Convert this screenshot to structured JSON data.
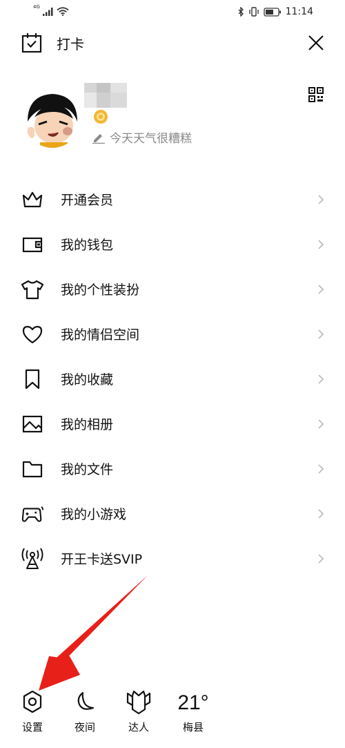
{
  "status_bar": {
    "network": "4G",
    "time": "11:14"
  },
  "header": {
    "checkin_label": "打卡"
  },
  "profile": {
    "signature": "今天天气很糟糕"
  },
  "menu": {
    "items": [
      {
        "icon": "crown-icon",
        "label": "开通会员"
      },
      {
        "icon": "wallet-icon",
        "label": "我的钱包"
      },
      {
        "icon": "tshirt-icon",
        "label": "我的个性装扮"
      },
      {
        "icon": "heart-icon",
        "label": "我的情侣空间"
      },
      {
        "icon": "bookmark-icon",
        "label": "我的收藏"
      },
      {
        "icon": "photo-album-icon",
        "label": "我的相册"
      },
      {
        "icon": "folder-icon",
        "label": "我的文件"
      },
      {
        "icon": "gamepad-icon",
        "label": "我的小游戏"
      },
      {
        "icon": "broadcast-icon",
        "label": "开王卡送SVIP"
      }
    ]
  },
  "bottom_bar": {
    "settings_label": "设置",
    "night_label": "夜间",
    "expert_label": "达人",
    "temperature": "21°",
    "city": "梅县"
  },
  "accent_colors": {
    "annotation_arrow": "#e8201a",
    "badge_gold": "#f2b632"
  }
}
